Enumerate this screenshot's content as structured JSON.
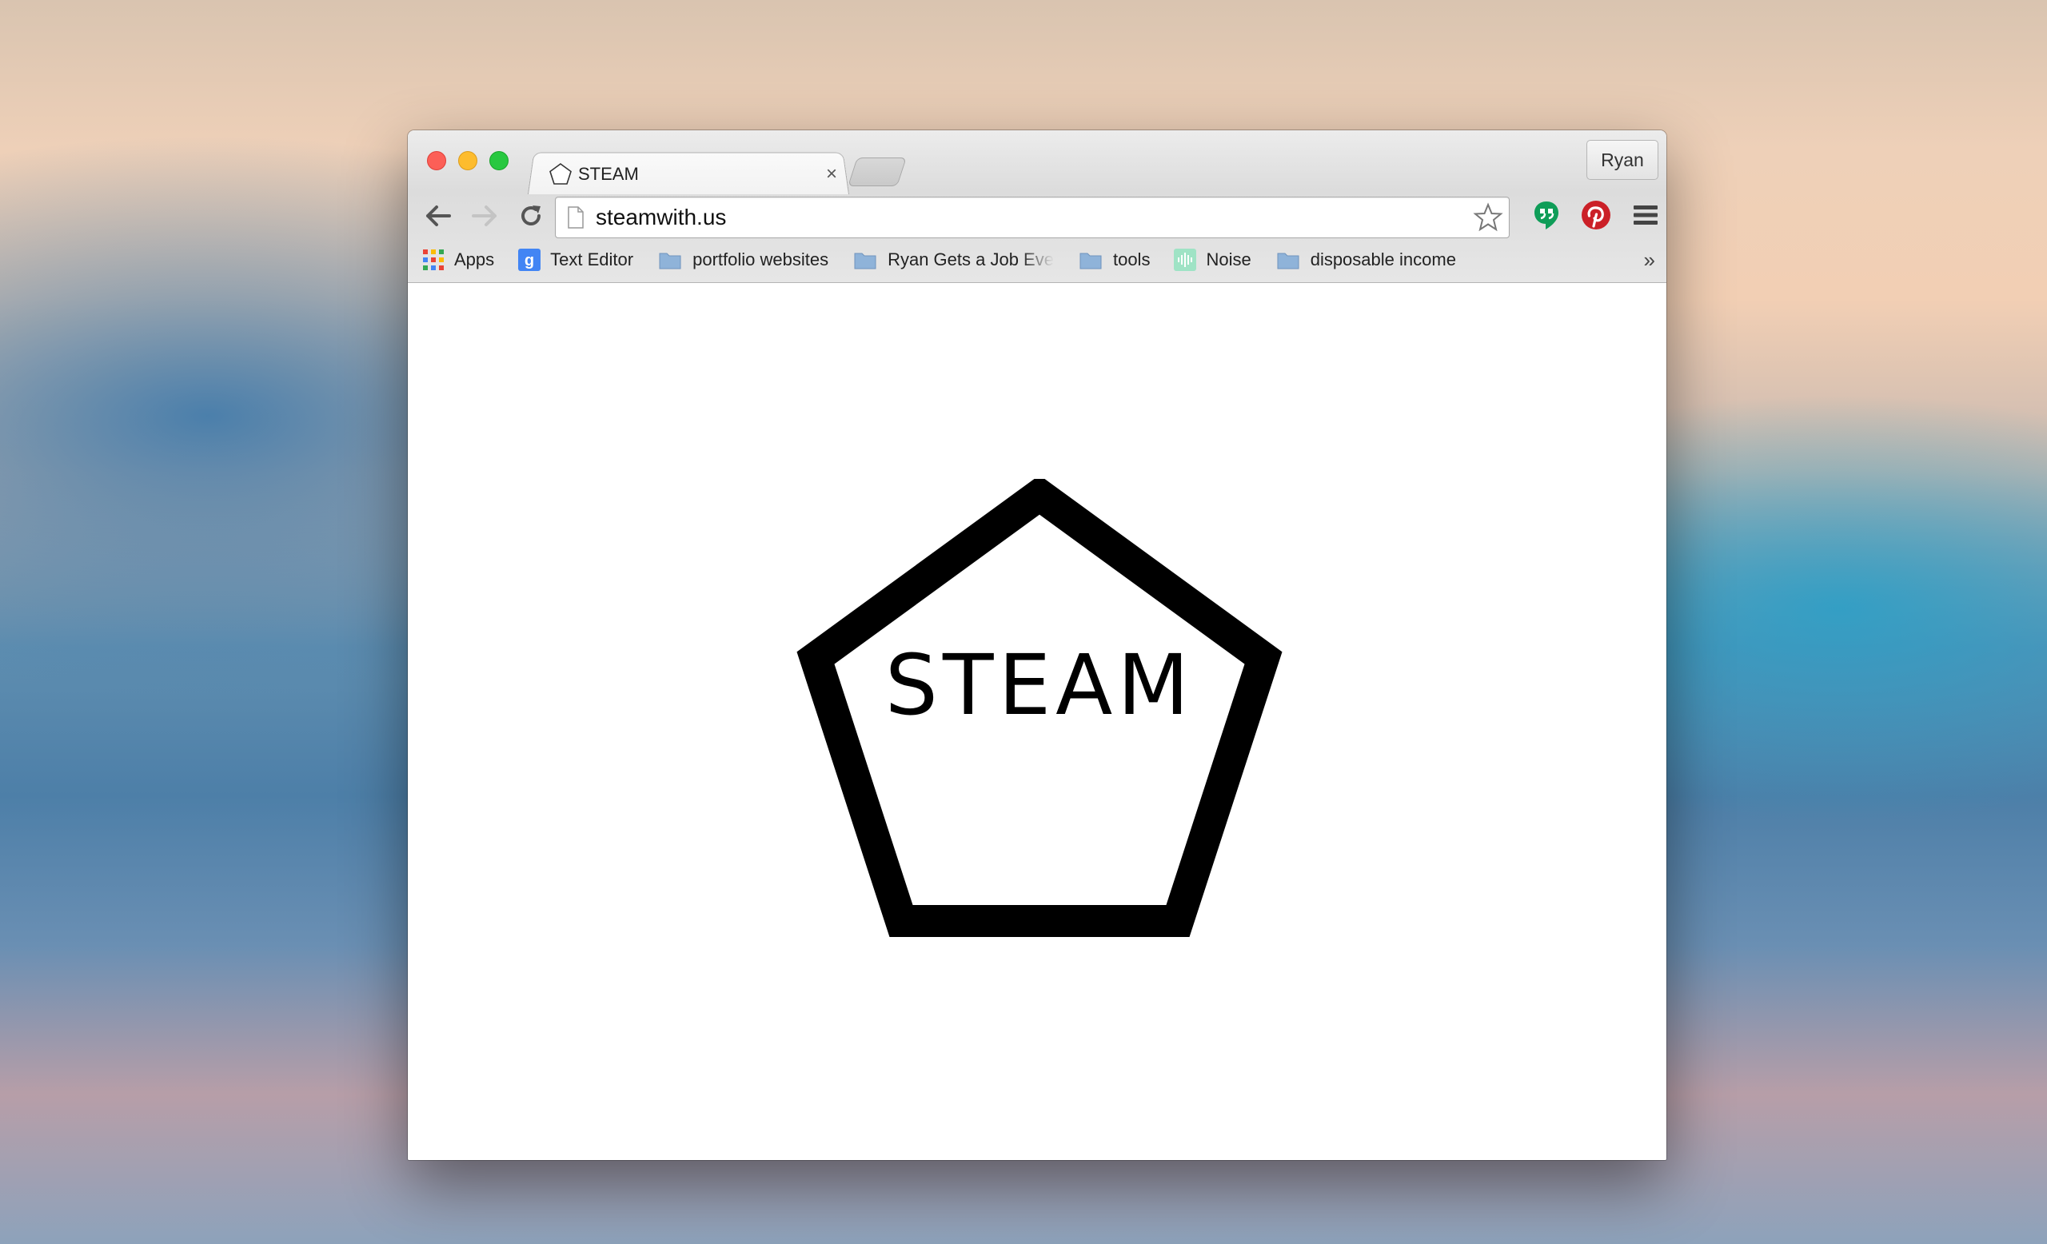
{
  "tab": {
    "title": "STEAM",
    "close": "×"
  },
  "profile": {
    "name": "Ryan"
  },
  "omnibox": {
    "url": "steamwith.us"
  },
  "bookmarks": [
    {
      "label": "Apps",
      "icon": "apps-grid-icon"
    },
    {
      "label": "Text Editor",
      "icon": "google-icon"
    },
    {
      "label": "portfolio websites",
      "icon": "folder-icon"
    },
    {
      "label": "Ryan Gets a Job Eve",
      "icon": "folder-icon"
    },
    {
      "label": "tools",
      "icon": "folder-icon"
    },
    {
      "label": "Noise",
      "icon": "noise-icon"
    },
    {
      "label": "disposable income",
      "icon": "folder-icon"
    }
  ],
  "overflow": "»",
  "page": {
    "logo_text": "STEAM"
  },
  "colors": {
    "pinterest": "#cb2027",
    "hangouts": "#0f9d58",
    "folder": "#8fb3d9"
  }
}
